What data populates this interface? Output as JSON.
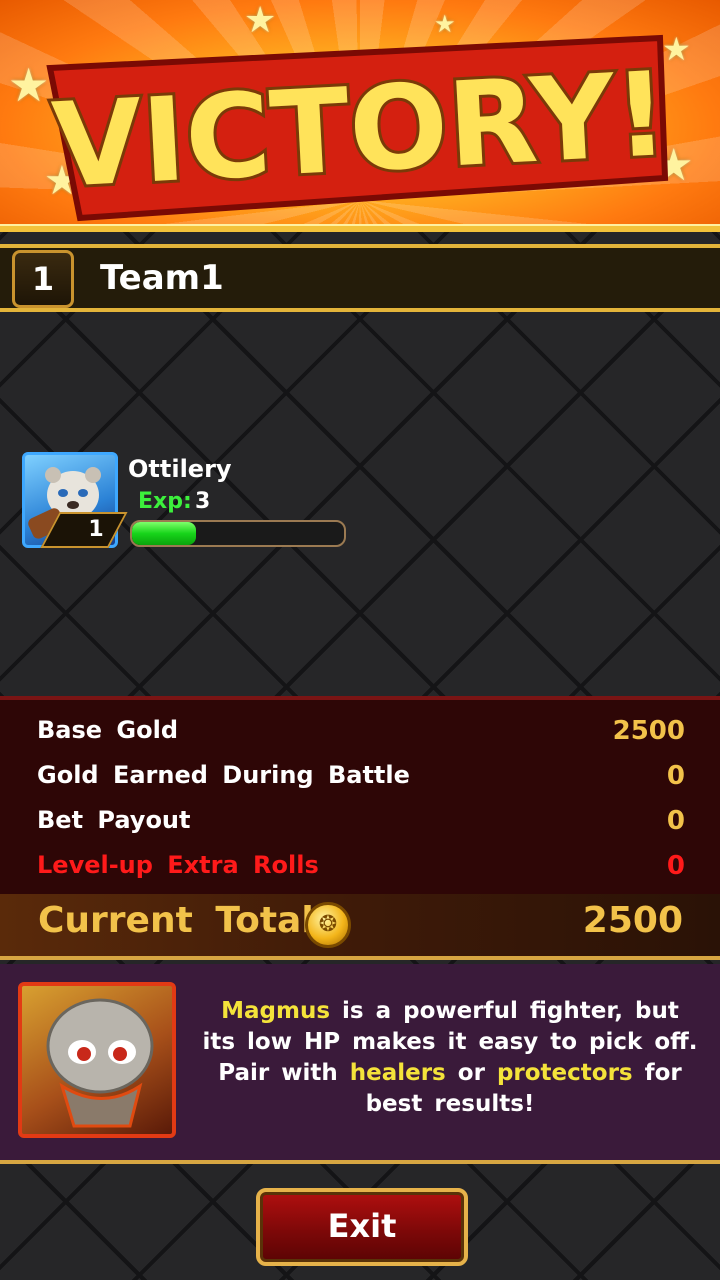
{
  "banner": {
    "title": "VICTORY!"
  },
  "team": {
    "rank": "1",
    "name": "Team1"
  },
  "hero": {
    "name": "Ottilery",
    "level": "1",
    "exp_label": "Exp:",
    "exp_value": "3",
    "exp_progress": 0.3
  },
  "rewards": {
    "rows": [
      {
        "label": "Base Gold",
        "value": "2500",
        "color": "#ffffff",
        "value_color": "#f2c24a"
      },
      {
        "label": "Gold Earned During Battle",
        "value": "0",
        "color": "#ffffff",
        "value_color": "#f2c24a"
      },
      {
        "label": "Bet Payout",
        "value": "0",
        "color": "#ffffff",
        "value_color": "#f2c24a"
      },
      {
        "label": "Level-up Extra Rolls",
        "value": "0",
        "color": "#ff1a1a",
        "value_color": "#ff1a1a"
      }
    ],
    "total_label": "Current Total",
    "total_value": "2500",
    "coin_icon": "gold-coin-icon"
  },
  "tip": {
    "hero": "Magmus",
    "t1": "is a powerful fighter, but its low HP makes it easy to pick off. Pair with",
    "healers": "healers",
    "or": "or",
    "protectors": "protectors",
    "t2": "for best results!"
  },
  "exit_label": "Exit",
  "colors": {
    "accent": "#f2c24a",
    "highlight": "#f4e33a",
    "exp_green": "#3cf03c"
  }
}
